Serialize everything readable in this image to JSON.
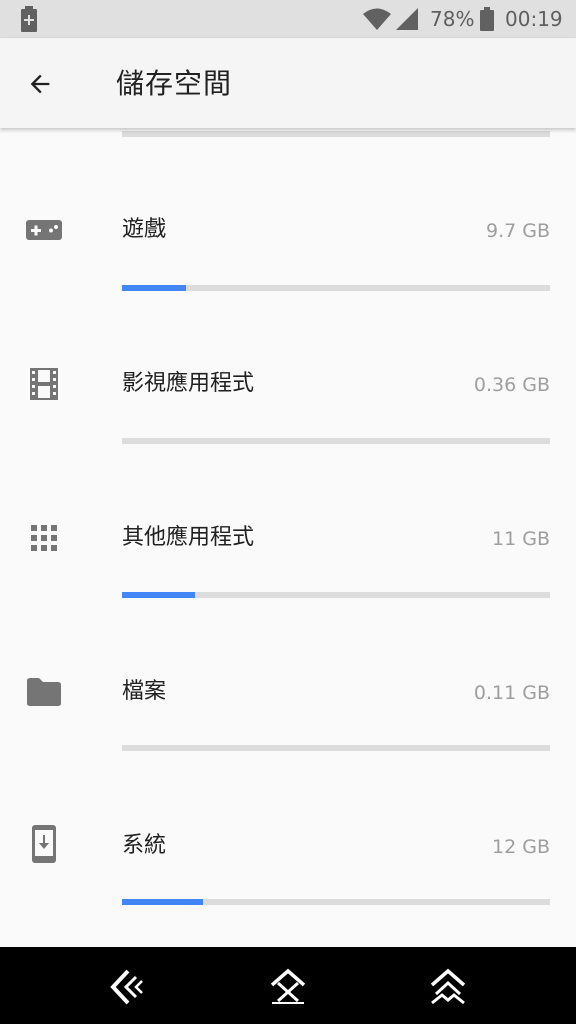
{
  "status_bar": {
    "battery_percent": "78%",
    "time": "00:19"
  },
  "app_bar": {
    "title": "儲存空間"
  },
  "items": [
    {
      "label": "遊戲",
      "size": "9.7 GB",
      "usage_fraction": 0.15,
      "icon": "gamepad-icon"
    },
    {
      "label": "影視應用程式",
      "size": "0.36 GB",
      "usage_fraction": 0.0,
      "icon": "film-icon"
    },
    {
      "label": "其他應用程式",
      "size": "11 GB",
      "usage_fraction": 0.17,
      "icon": "apps-grid-icon"
    },
    {
      "label": "檔案",
      "size": "0.11 GB",
      "usage_fraction": 0.0,
      "icon": "folder-icon"
    },
    {
      "label": "系統",
      "size": "12 GB",
      "usage_fraction": 0.19,
      "icon": "system-update-icon"
    }
  ],
  "colors": {
    "accent": "#4285f4",
    "track": "#dcdcdc",
    "icon": "#757575"
  }
}
